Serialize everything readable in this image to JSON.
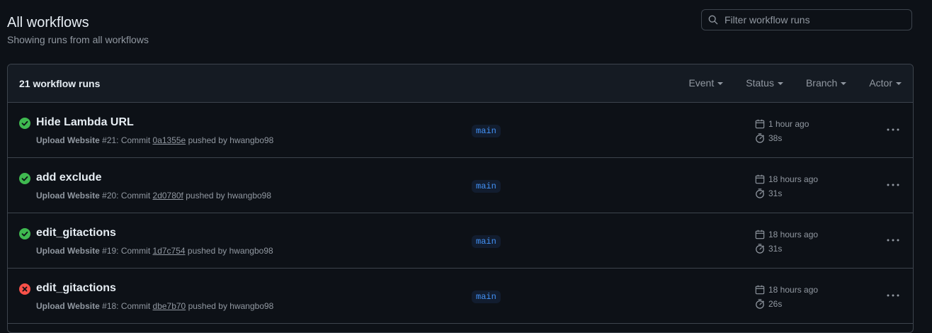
{
  "header": {
    "title": "All workflows",
    "subtitle": "Showing runs from all workflows"
  },
  "search": {
    "placeholder": "Filter workflow runs",
    "value": ""
  },
  "runs_header": {
    "count_label": "21 workflow runs",
    "filters": [
      "Event",
      "Status",
      "Branch",
      "Actor"
    ]
  },
  "colors": {
    "success": "#3fb950",
    "failure": "#f85149",
    "accent": "#4493f8"
  },
  "runs": [
    {
      "status": "success",
      "title": "Hide Lambda URL",
      "workflow": "Upload Website",
      "run_number": "#21",
      "commit_prefix": ": Commit ",
      "commit_sha": "0a1355e",
      "pushed_by": " pushed by hwangbo98",
      "branch": "main",
      "created": "1 hour ago",
      "duration": "38s"
    },
    {
      "status": "success",
      "title": "add exclude",
      "workflow": "Upload Website",
      "run_number": "#20",
      "commit_prefix": ": Commit ",
      "commit_sha": "2d0780f",
      "pushed_by": " pushed by hwangbo98",
      "branch": "main",
      "created": "18 hours ago",
      "duration": "31s"
    },
    {
      "status": "success",
      "title": "edit_gitactions",
      "workflow": "Upload Website",
      "run_number": "#19",
      "commit_prefix": ": Commit ",
      "commit_sha": "1d7c754",
      "pushed_by": " pushed by hwangbo98",
      "branch": "main",
      "created": "18 hours ago",
      "duration": "31s"
    },
    {
      "status": "failure",
      "title": "edit_gitactions",
      "workflow": "Upload Website",
      "run_number": "#18",
      "commit_prefix": ": Commit ",
      "commit_sha": "dbe7b70",
      "pushed_by": " pushed by hwangbo98",
      "branch": "main",
      "created": "18 hours ago",
      "duration": "26s"
    }
  ]
}
